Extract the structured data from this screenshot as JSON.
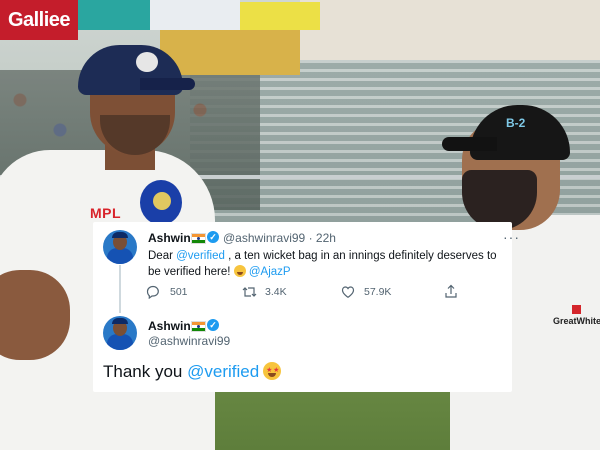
{
  "background": {
    "banner_text": "Galliee",
    "shirt_sponsor": "MPL",
    "opponent_sponsor": "GreatWhite",
    "cap_logo": "B-2"
  },
  "tweet": {
    "author_name": "Ashwin",
    "author_flag": "flag-india-icon",
    "handle": "@ashwinravi99",
    "time": "· 22h",
    "more": "···",
    "text_before": "Dear ",
    "mention_verified": "@verified",
    "text_middle": " , a ten wicket bag in an innings definitely deserves to be verified here! ",
    "mention_ajaz": "@AjazP",
    "replies": "501",
    "retweets": "3.4K",
    "likes": "57.9K"
  },
  "reply": {
    "author_name": "Ashwin",
    "handle": "@ashwinravi99",
    "text_before": "Thank you ",
    "mention_verified": "@verified"
  },
  "colors": {
    "link": "#1d9bf0",
    "text": "#0f1419",
    "muted": "#536471"
  }
}
